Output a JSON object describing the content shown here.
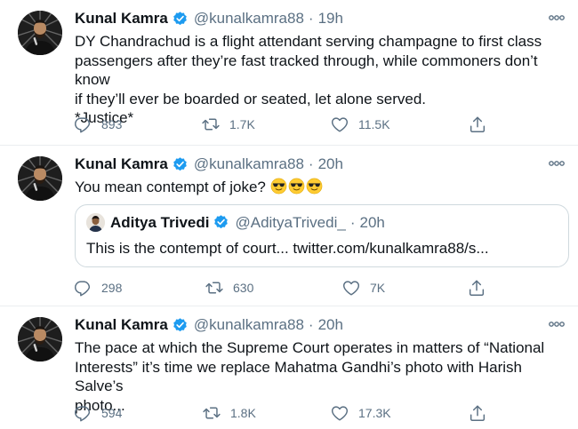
{
  "tweets": [
    {
      "author": {
        "name": "Kunal Kamra",
        "handle": "@kunalkamra88",
        "verified": true
      },
      "time": "19h",
      "text": [
        "DY Chandrachud is a flight attendant serving champagne to first class",
        "passengers after they’re fast tracked through, while commoners don’t know",
        "if they’ll ever be boarded or seated, let alone served.",
        "*Justice*"
      ],
      "replies": "893",
      "retweets": "1.7K",
      "likes": "11.5K"
    },
    {
      "author": {
        "name": "Kunal Kamra",
        "handle": "@kunalkamra88",
        "verified": true
      },
      "time": "20h",
      "text": [
        "You mean contempt of joke?"
      ],
      "emoji": [
        "sunglasses-emoji",
        "sunglasses-emoji",
        "sunglasses-emoji"
      ],
      "quoted": {
        "name": "Aditya Trivedi",
        "handle": "@AdityaTrivedi_",
        "time": "20h",
        "verified": true,
        "text": "This is the contempt of court... twitter.com/kunalkamra88/s..."
      },
      "replies": "298",
      "retweets": "630",
      "likes": "7K"
    },
    {
      "author": {
        "name": "Kunal Kamra",
        "handle": "@kunalkamra88",
        "verified": true
      },
      "time": "20h",
      "text": [
        "The pace at which the Supreme Court operates in matters of “National",
        "Interests” it’s time we replace Mahatma Gandhi’s photo with Harish Salve’s",
        "photo..."
      ],
      "replies": "594",
      "retweets": "1.8K",
      "likes": "17.3K"
    }
  ],
  "colors": {
    "text": "#0f1419",
    "muted": "#5b7083",
    "verified": "#1d9bf0",
    "divider": "#ebeef0",
    "quote_border": "#cfd9de"
  },
  "icons": {
    "reply": "reply-icon",
    "retweet": "retweet-icon",
    "like": "like-icon",
    "share": "share-icon",
    "more": "more-icon",
    "verified": "verified-badge-icon"
  }
}
